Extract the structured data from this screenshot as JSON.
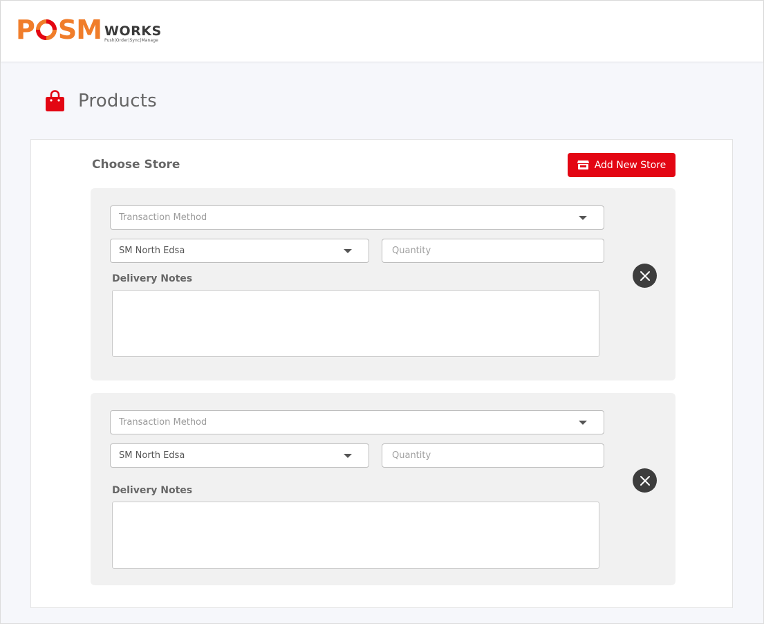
{
  "header": {
    "logo": {
      "brand_start": "P",
      "brand_end": "SM",
      "brand_suffix": "WORKS",
      "tagline": "Push|Order|Sync|Manage"
    }
  },
  "page": {
    "title": "Products",
    "title_icon": "shopping-bag-icon"
  },
  "colors": {
    "brand_orange": "#f07d2a",
    "accent_red": "#e30613",
    "dark_button": "#3d3d3d",
    "panel_bg": "#f1f1f1"
  },
  "card": {
    "heading": "Choose Store",
    "add_store_button": {
      "label": "Add New Store",
      "icon": "store-icon"
    }
  },
  "stores": [
    {
      "transaction_method": {
        "placeholder": "Transaction Method",
        "value": ""
      },
      "store_select": {
        "value": "SM North Edsa"
      },
      "quantity": {
        "placeholder": "Quantity",
        "value": ""
      },
      "delivery_notes": {
        "label": "Delivery Notes",
        "value": ""
      },
      "remove_icon": "close-icon"
    },
    {
      "transaction_method": {
        "placeholder": "Transaction Method",
        "value": ""
      },
      "store_select": {
        "value": "SM North Edsa"
      },
      "quantity": {
        "placeholder": "Quantity",
        "value": ""
      },
      "delivery_notes": {
        "label": "Delivery Notes",
        "value": ""
      },
      "remove_icon": "close-icon"
    }
  ]
}
